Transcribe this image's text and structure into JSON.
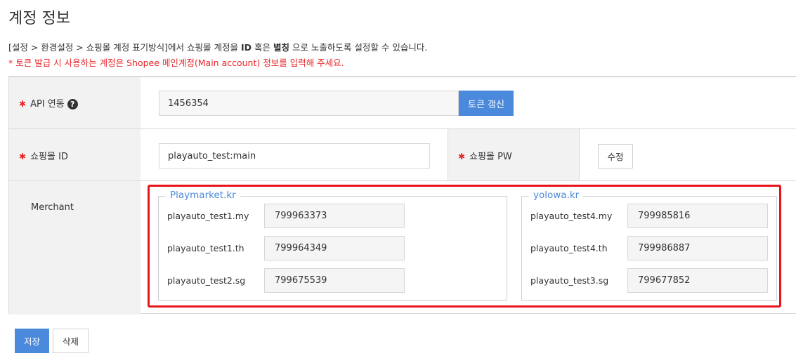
{
  "page": {
    "title": "계정 정보",
    "desc_part1": "[설정 > 환경설정 > 쇼핑몰 계정 표기방식]에서 쇼핑몰 계정을 ",
    "desc_id": "ID",
    "desc_part2": " 혹은 ",
    "desc_alias": "별칭",
    "desc_part3": " 으로 노출하도록 설정할 수 있습니다.",
    "warning": "* 토큰 발급 시 사용하는 계정은 Shopee 메인계정(Main account) 정보를 입력해 주세요."
  },
  "form": {
    "required_mark": "✱",
    "api_label": "API 연동",
    "api_help_icon": "?",
    "api_value": "1456354",
    "token_button": "토큰 갱신",
    "shop_id_label": "쇼핑몰 ID",
    "shop_id_value": "playauto_test:main",
    "shop_pw_label": "쇼핑몰 PW",
    "edit_button": "수정",
    "merchant_label": "Merchant"
  },
  "merchants": [
    {
      "name": "Playmarket.kr",
      "rows": [
        {
          "account": "playauto_test1.my",
          "id": "799963373"
        },
        {
          "account": "playauto_test1.th",
          "id": "799964349"
        },
        {
          "account": "playauto_test2.sg",
          "id": "799675539"
        }
      ]
    },
    {
      "name": "yolowa.kr",
      "rows": [
        {
          "account": "playauto_test4.my",
          "id": "799985816"
        },
        {
          "account": "playauto_test4.th",
          "id": "799986887"
        },
        {
          "account": "playauto_test3.sg",
          "id": "799677852"
        }
      ]
    }
  ],
  "actions": {
    "save": "저장",
    "delete": "삭제"
  },
  "colors": {
    "accent": "#4a89dc",
    "required": "#e8262a",
    "highlight": "#e8141b"
  }
}
